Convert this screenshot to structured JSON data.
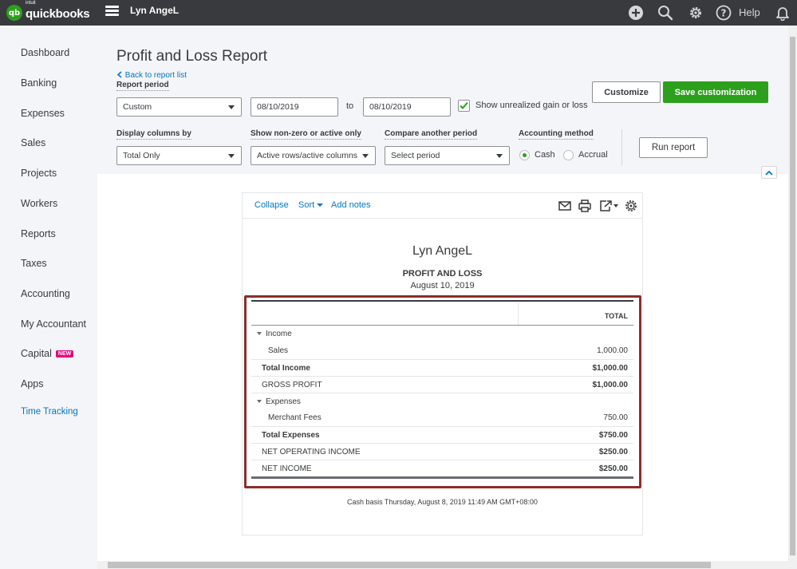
{
  "topbar": {
    "logo_intuit": "intuit",
    "logo_text": "quickbooks",
    "logo_mark": "qb",
    "company_name": "Lyn AngeL",
    "help_label": "Help"
  },
  "sidebar": {
    "items": [
      {
        "label": "Dashboard"
      },
      {
        "label": "Banking"
      },
      {
        "label": "Expenses"
      },
      {
        "label": "Sales"
      },
      {
        "label": "Projects"
      },
      {
        "label": "Workers"
      },
      {
        "label": "Reports"
      },
      {
        "label": "Taxes"
      },
      {
        "label": "Accounting"
      },
      {
        "label": "My Accountant"
      },
      {
        "label": "Capital",
        "badge": "NEW"
      },
      {
        "label": "Apps"
      },
      {
        "label": "Time Tracking"
      }
    ]
  },
  "header": {
    "title": "Profit and Loss Report",
    "back_link": "Back to report list"
  },
  "filters": {
    "report_period_label": "Report period",
    "report_period_value": "Custom",
    "from_date": "08/10/2019",
    "to_label": "to",
    "to_date": "08/10/2019",
    "unrealized_label": "Show unrealized gain or loss",
    "unrealized_checked": true,
    "display_columns_label": "Display columns by",
    "display_columns_value": "Total Only",
    "non_zero_label": "Show non-zero or active only",
    "non_zero_value": "Active rows/active columns",
    "compare_label": "Compare another period",
    "compare_placeholder": "Select period",
    "accounting_method_label": "Accounting method",
    "method_cash": "Cash",
    "method_accrual": "Accrual",
    "selected_method": "Cash"
  },
  "actions": {
    "customize": "Customize",
    "save_customization": "Save customization",
    "run_report": "Run report"
  },
  "report_toolbar": {
    "collapse": "Collapse",
    "sort": "Sort",
    "add_notes": "Add notes"
  },
  "report": {
    "company": "Lyn AngeL",
    "title": "PROFIT AND LOSS",
    "date": "August 10, 2019",
    "column_header": "TOTAL",
    "rows": [
      {
        "label": "Income",
        "value": ""
      },
      {
        "label": "Sales",
        "value": "1,000.00"
      },
      {
        "label": "Total Income",
        "value": "$1,000.00"
      },
      {
        "label": "GROSS PROFIT",
        "value": "$1,000.00"
      },
      {
        "label": "Expenses",
        "value": ""
      },
      {
        "label": "Merchant Fees",
        "value": "750.00"
      },
      {
        "label": "Total Expenses",
        "value": "$750.00"
      },
      {
        "label": "NET OPERATING INCOME",
        "value": "$250.00"
      },
      {
        "label": "NET INCOME",
        "value": "$250.00"
      }
    ],
    "footer": "Cash basis  Thursday, August 8, 2019  11:49 AM GMT+08:00"
  },
  "colors": {
    "topbar": "#393a3d",
    "primary_green": "#2ca01c",
    "link_blue": "#0077c5",
    "highlight_border": "#8b2d2d",
    "badge_pink": "#e6007e"
  }
}
